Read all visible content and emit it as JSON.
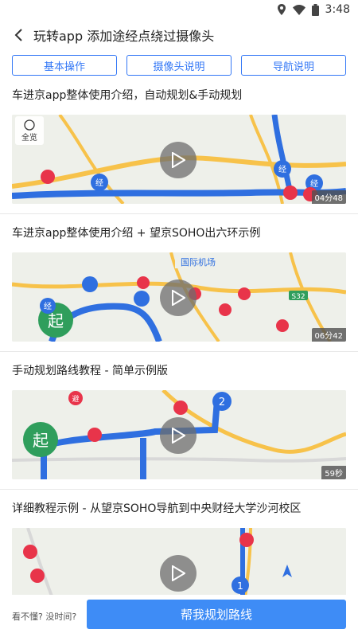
{
  "status_bar": {
    "time": "3:48",
    "icons": [
      "location-icon",
      "wifi-icon",
      "battery-icon"
    ]
  },
  "header": {
    "title": "玩转app 添加途经点绕过摄像头",
    "back_icon": "back-arrow-icon"
  },
  "tabs": [
    {
      "label": "基本操作"
    },
    {
      "label": "摄像头说明"
    },
    {
      "label": "导航说明"
    }
  ],
  "videos": [
    {
      "title": "车进京app整体使用介绍，自动规划&手动规划",
      "duration": "04分48",
      "overview_label": "全览"
    },
    {
      "title": "车进京app整体使用介绍 + 望京SOHO出六环示例",
      "duration": "06分42",
      "map_labels": [
        "国际机场",
        "S32",
        "起",
        "经"
      ]
    },
    {
      "title": "手动规划路线教程 - 简单示例版",
      "duration": "59秒",
      "map_labels": [
        "起",
        "2",
        "避"
      ]
    },
    {
      "title": "详细教程示例 - 从望京SOHO导航到中央财经大学沙河校区",
      "duration": "",
      "map_labels": [
        "1"
      ]
    }
  ],
  "bottom": {
    "help_text": "看不懂? 没时间?",
    "cta_label": "帮我规划路线"
  },
  "colors": {
    "accent": "#3478f6",
    "cta": "#3e8cf6",
    "route": "#2f6fe0",
    "road": "#f7c24a",
    "camera": "#e8344a"
  }
}
